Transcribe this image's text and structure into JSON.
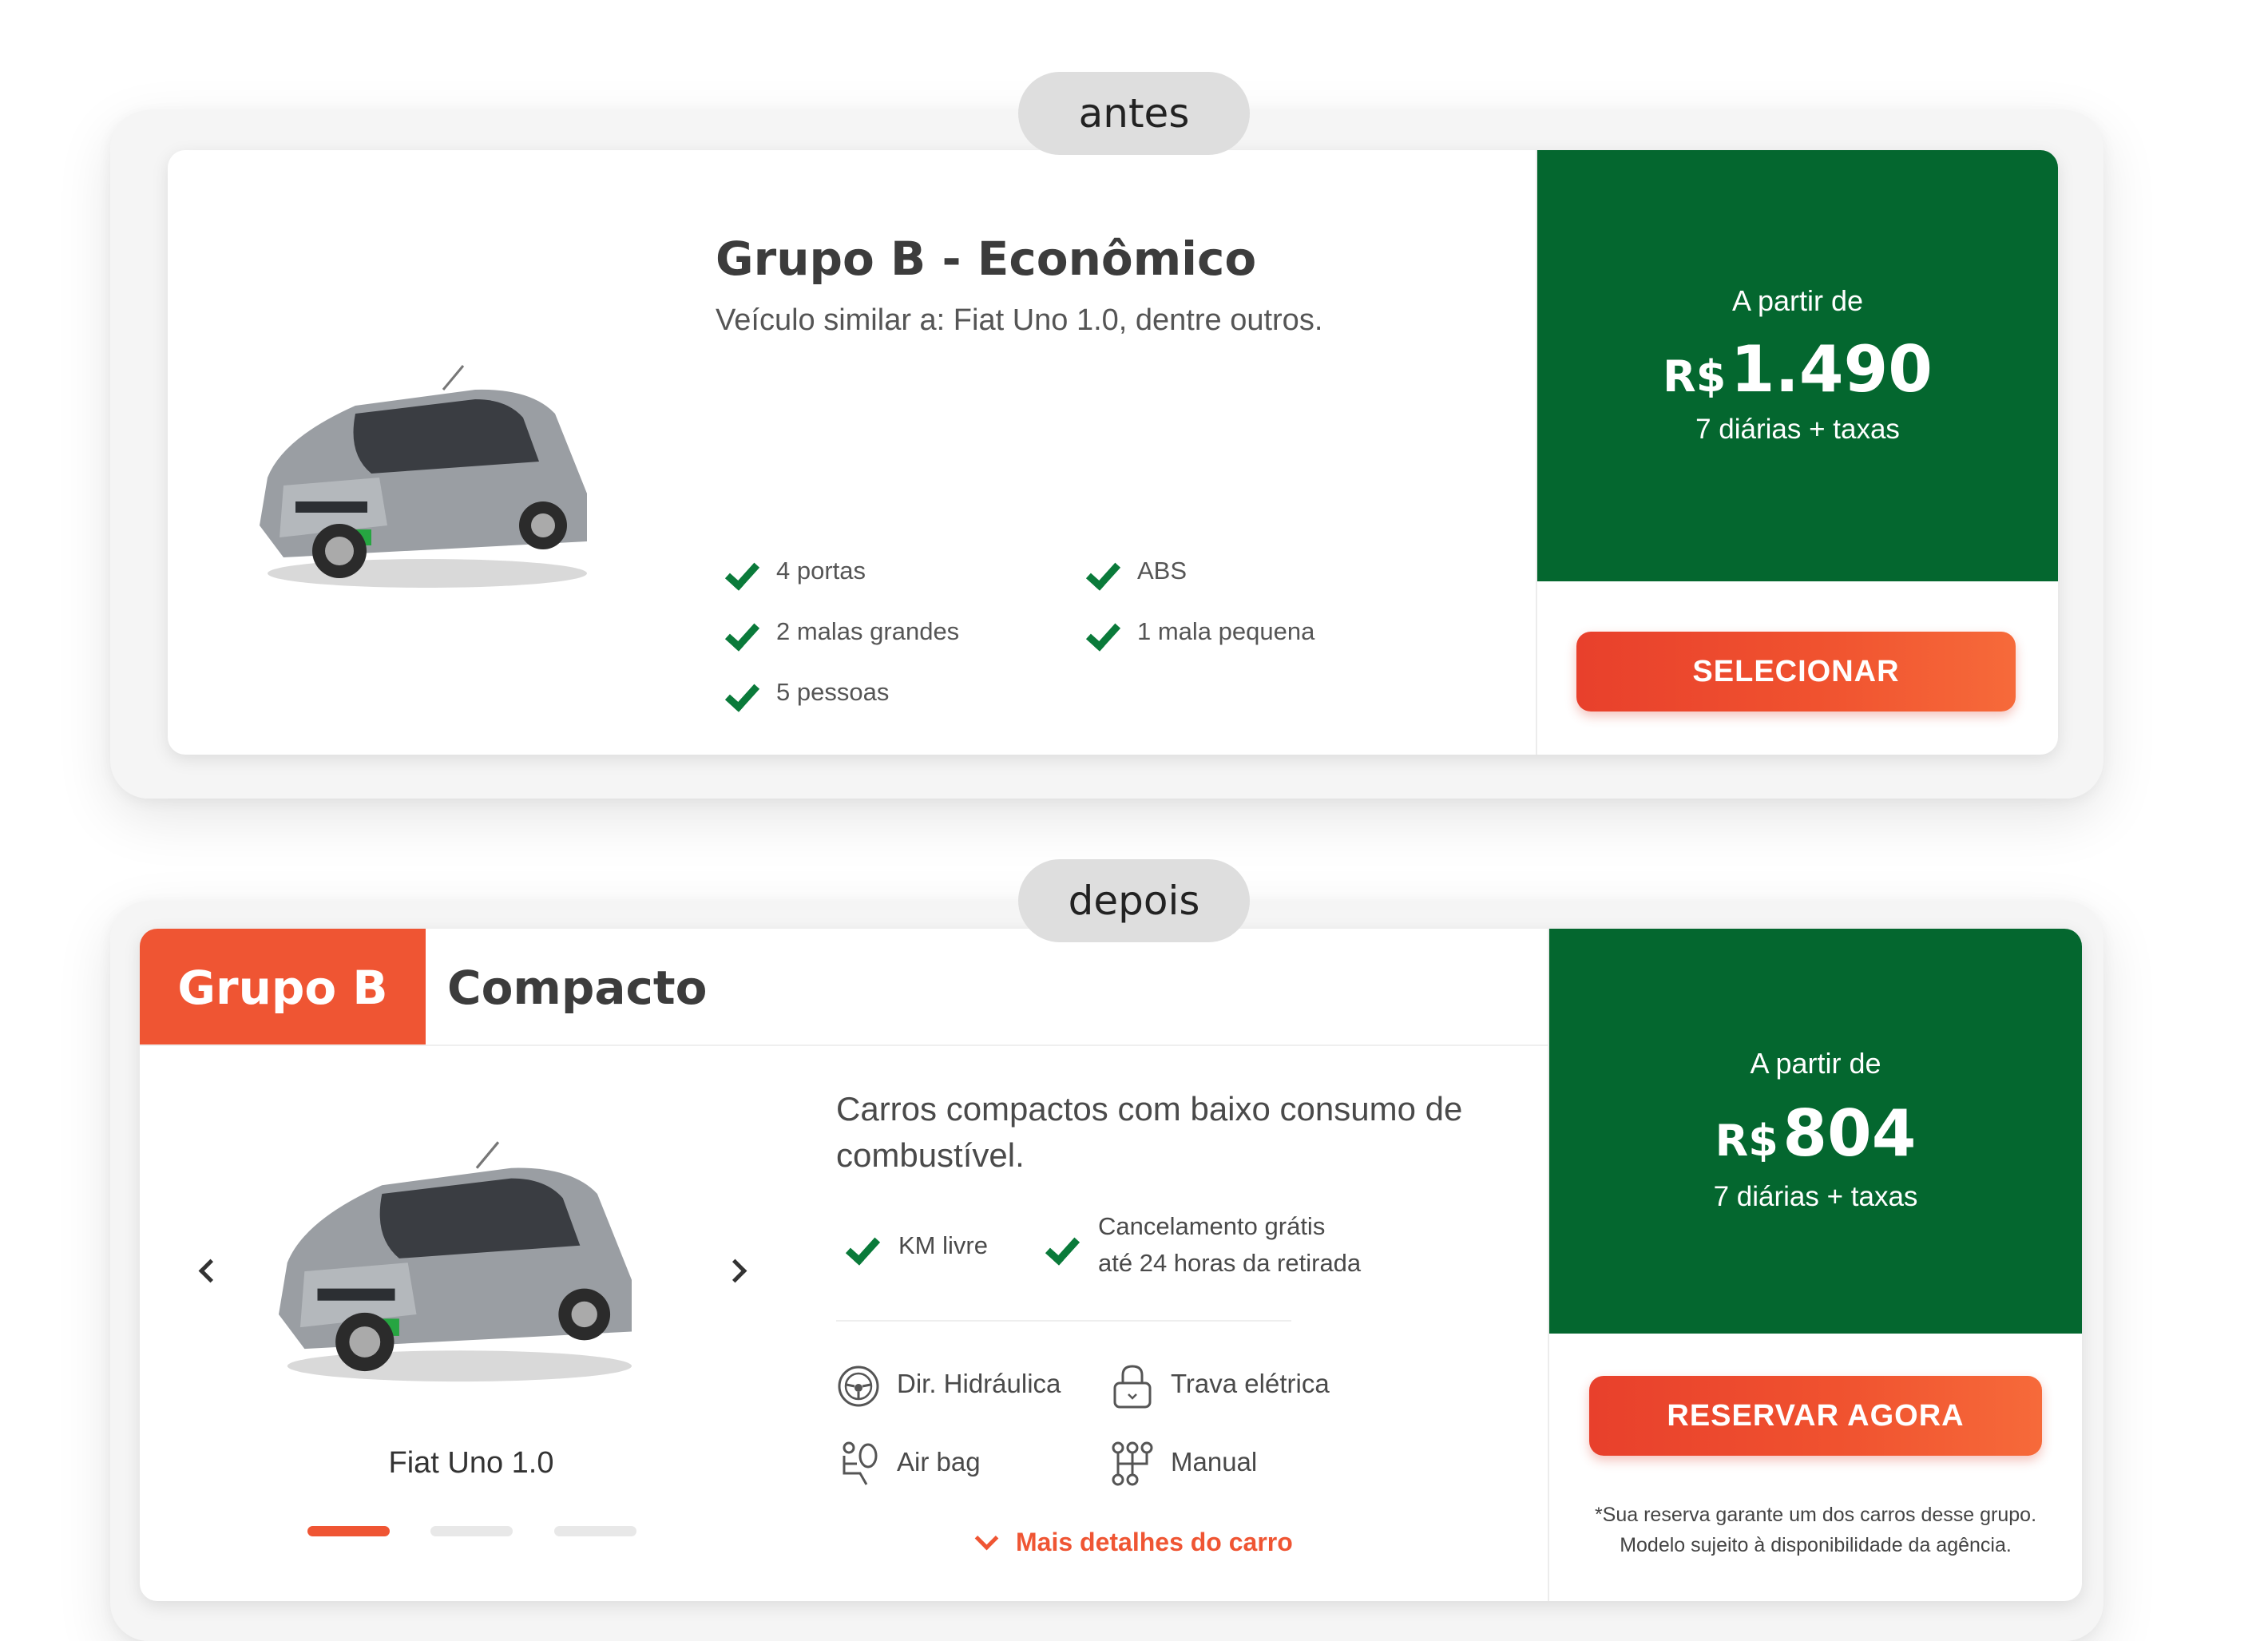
{
  "before": {
    "label": "antes",
    "title": "Grupo B - Econômico",
    "subtitle": "Veículo similar a: Fiat Uno 1.0, dentre outros.",
    "features": [
      "4 portas",
      "ABS",
      "2 malas grandes",
      "1 mala pequena",
      "5 pessoas"
    ],
    "price": {
      "from_label": "A partir de",
      "currency": "R$",
      "amount": "1.490",
      "note": "7 diárias + taxas"
    },
    "select_button": "SELECIONAR"
  },
  "after": {
    "label": "depois",
    "group_tag": "Grupo B",
    "category": "Compacto",
    "description": "Carros compactos com baixo consumo de combustível.",
    "benefits": [
      "KM livre",
      "Cancelamento grátis\naté 24 horas da retirada"
    ],
    "specs": [
      {
        "label": "Dir. Hidráulica",
        "icon": "steering-wheel-icon"
      },
      {
        "label": "Trava elétrica",
        "icon": "lock-icon"
      },
      {
        "label": "Air bag",
        "icon": "airbag-icon"
      },
      {
        "label": "Manual",
        "icon": "gear-shift-icon"
      }
    ],
    "car_name": "Fiat Uno 1.0",
    "carousel": {
      "total": 3,
      "active": 1
    },
    "more_details": "Mais detalhes do carro",
    "price": {
      "from_label": "A partir de",
      "currency": "R$",
      "amount": "804",
      "note": "7 diárias + taxas"
    },
    "reserve_button": "RESERVAR AGORA",
    "disclaimer": "*Sua reserva garante um dos carros desse grupo.\nModelo sujeito à disponibilidade da agência."
  },
  "colors": {
    "green": "#04672f",
    "orange_red": "#ef5533",
    "check_green": "#0a7a3a"
  }
}
